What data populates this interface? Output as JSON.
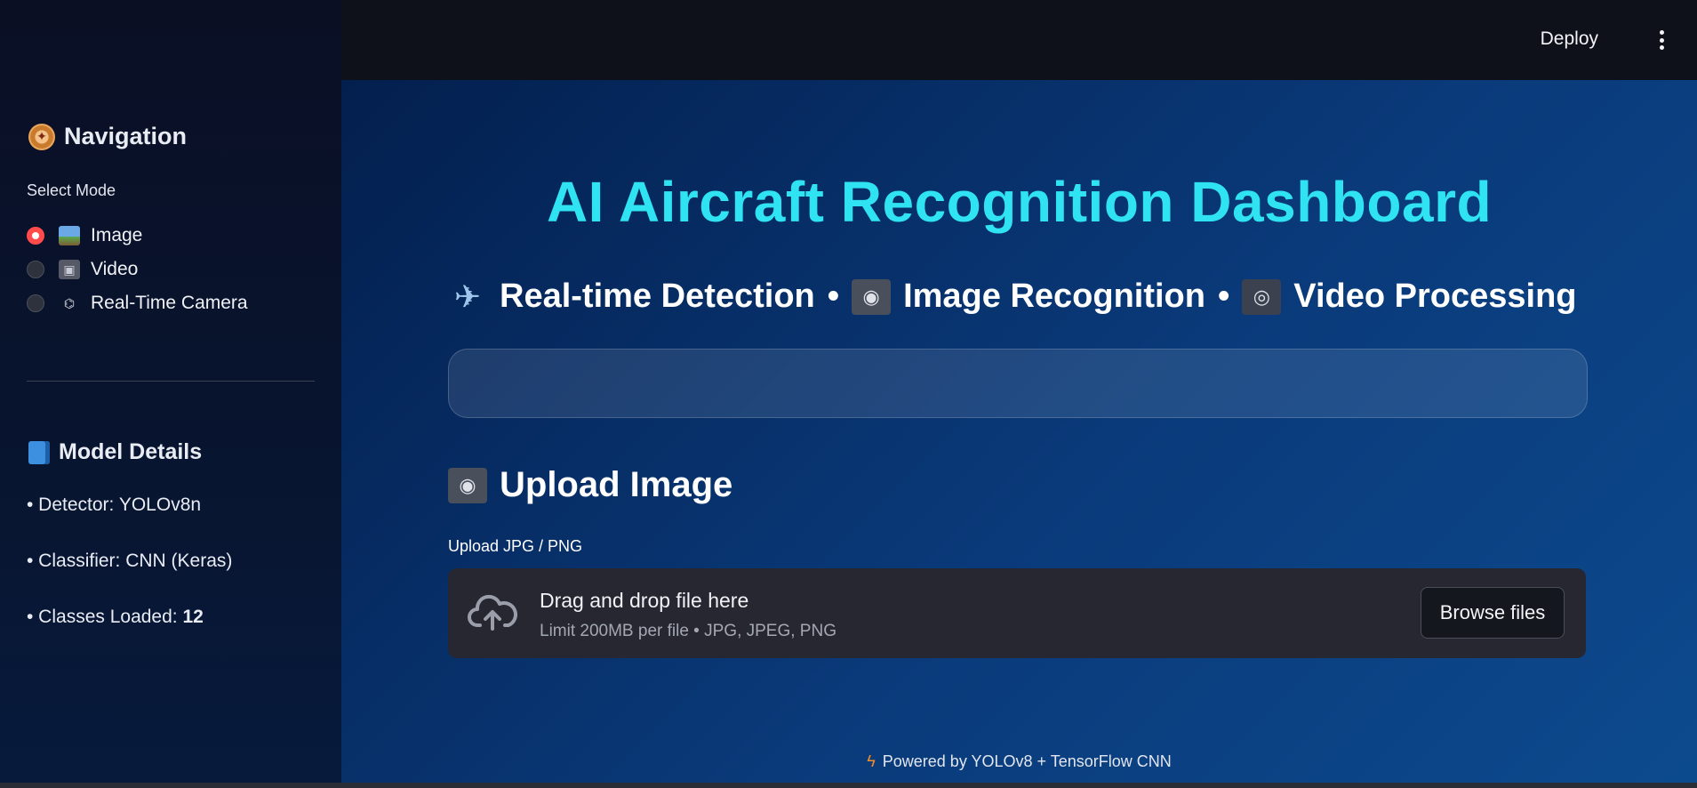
{
  "header": {
    "deploy_label": "Deploy",
    "menu_icon": "kebab-menu-icon"
  },
  "sidebar": {
    "nav_title": "Navigation",
    "nav_icon": "compass-icon",
    "select_label": "Select Mode",
    "modes": [
      {
        "label": "Image",
        "icon": "framed-picture-icon",
        "selected": true
      },
      {
        "label": "Video",
        "icon": "film-projector-icon",
        "selected": false
      },
      {
        "label": "Real-Time Camera",
        "icon": "satellite-antenna-icon",
        "selected": false
      }
    ],
    "model_title": "Model Details",
    "model_icon": "blue-book-icon",
    "details": {
      "detector": "• Detector: YOLOv8n",
      "classifier": "• Classifier: CNN (Keras)",
      "classes_prefix": "• Classes Loaded: ",
      "classes_count": "12"
    }
  },
  "main": {
    "title": "AI Aircraft Recognition Dashboard",
    "subtitle": {
      "part1": "Real-time Detection",
      "part2": "Image Recognition",
      "part3": "Video Processing",
      "separator": "•"
    },
    "upload_heading": "Upload Image",
    "upload_label": "Upload JPG / PNG",
    "dropzone": {
      "title": "Drag and drop file here",
      "limit": "Limit 200MB per file • JPG, JPEG, PNG",
      "browse_label": "Browse files"
    },
    "footer": "Powered by YOLOv8 + TensorFlow CNN"
  },
  "colors": {
    "accent_title": "#2fe3f2",
    "radio_selected": "#ff4b4b",
    "footer_bolt": "#f28c28"
  }
}
